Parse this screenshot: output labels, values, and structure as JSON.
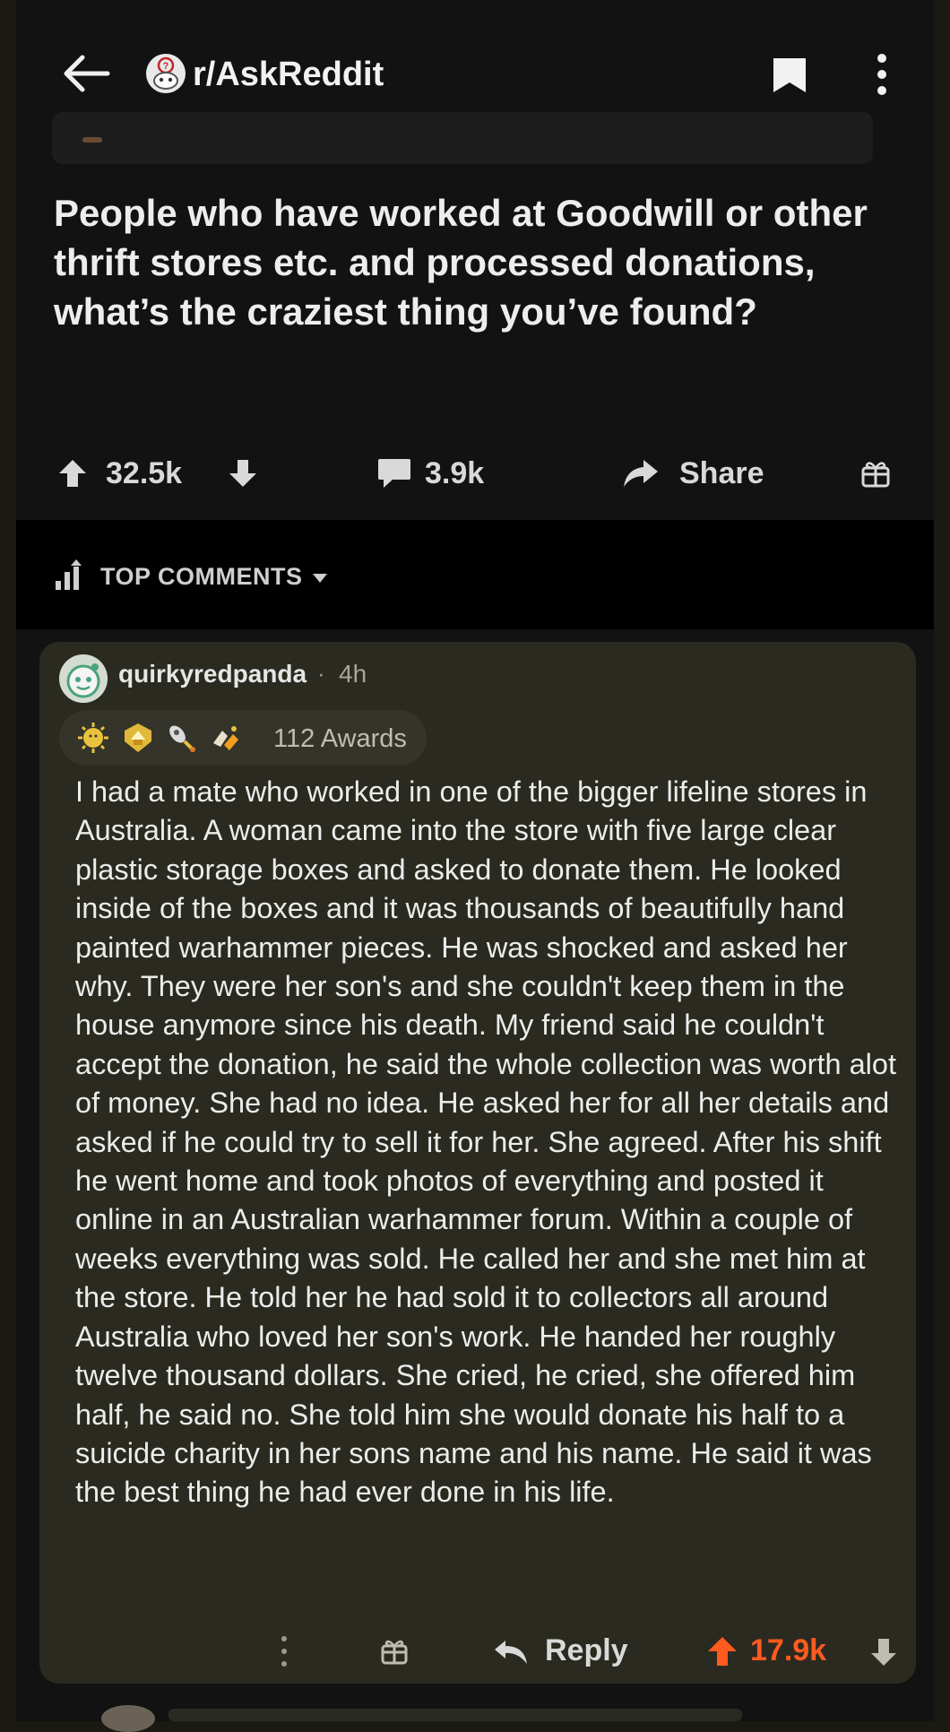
{
  "header": {
    "subreddit": "r/AskReddit",
    "icons": [
      "back-arrow-icon",
      "subreddit-avatar-icon",
      "bookmark-icon",
      "kebab-menu-icon"
    ]
  },
  "post": {
    "title": "People who have worked at Goodwill or other thrift stores etc. and processed donations, what’s the craziest thing you’ve found?",
    "upvotes": "32.5k",
    "comments": "3.9k",
    "share_label": "Share"
  },
  "sort": {
    "label": "TOP COMMENTS"
  },
  "comment": {
    "author": "quirkyredpanda",
    "separator": "·",
    "age": "4h",
    "awards_label": "112 Awards",
    "body": "I had a mate who worked in one of the bigger lifeline stores in Australia. A woman came into the store with five large clear plastic storage boxes and asked to donate them. He looked inside of the boxes and it was thousands of beautifully hand painted warhammer pieces. He was shocked and asked her why. They were her son's and she couldn't keep them in the house anymore since his death. My friend said he couldn't accept the donation, he said the whole collection was worth alot of money. She had no idea. He asked her for all her details and asked if he could try to sell it for her. She agreed. After his shift he went home and took photos of everything and posted it online in an Australian warhammer forum. Within a couple of weeks everything was sold. He called her and she met him at the store. He told her he had sold it to collectors all around Australia who loved her son's work. He handed her roughly twelve thousand dollars. She cried, he cried, she offered him half,  he said no. She told him she would donate his half to a suicide charity in her sons name and his name. He said it was the best thing he had ever done in his life.",
    "reply_label": "Reply",
    "score": "17.9k"
  },
  "colors": {
    "background": "#121212",
    "comment_bg": "#2b2a20",
    "upvote_accent": "#ff5a1f",
    "text": "#ececec"
  }
}
